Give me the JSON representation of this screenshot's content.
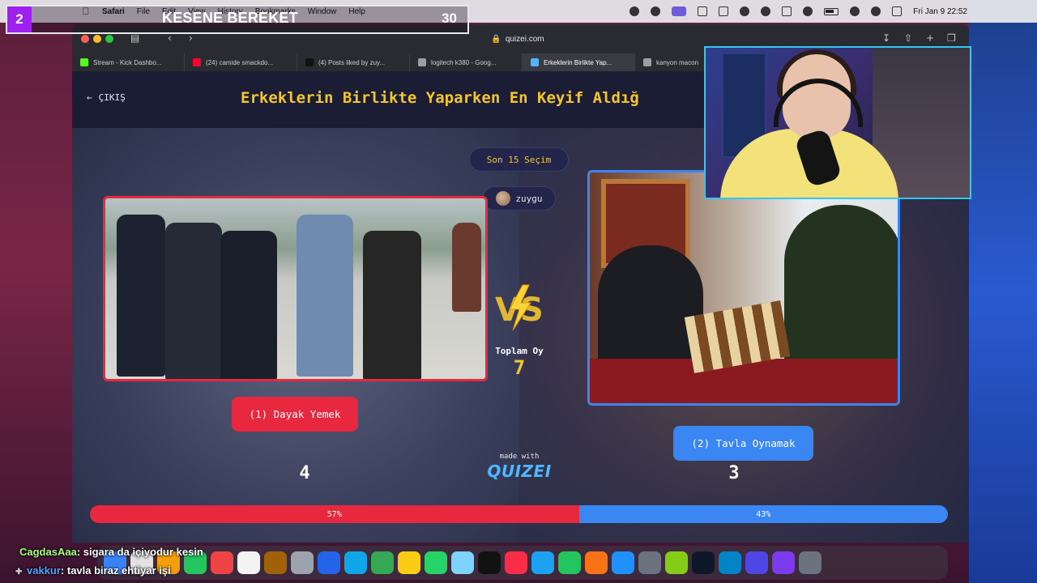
{
  "menubar": {
    "app": "Safari",
    "menus": [
      "File",
      "Edit",
      "View",
      "History",
      "Bookmarks",
      "Window",
      "Help"
    ],
    "clock": "Fri Jan 9  22:52"
  },
  "overlay": {
    "index": "2",
    "title": "KESENE BEREKET",
    "count": "30"
  },
  "browser": {
    "url": "quizei.com",
    "tabs": [
      {
        "label": "Stream - Kick Dashbo...",
        "color": "#53fc18",
        "active": false
      },
      {
        "label": "(24) camide smackdo...",
        "color": "#ff0033",
        "active": false
      },
      {
        "label": "(4) Posts liked by zuy...",
        "color": "#111111",
        "active": false
      },
      {
        "label": "logitech k380 - Goog...",
        "color": "#9aa0a6",
        "active": false
      },
      {
        "label": "Erkeklerin Birlikte Yap...",
        "color": "#4fb6ff",
        "active": true
      },
      {
        "label": "kanyon macon",
        "color": "#9aa0a6",
        "active": false
      }
    ]
  },
  "quiz": {
    "back_label": "ÇIKIŞ",
    "title": "Erkeklerin Birlikte Yaparken En Keyif Aldığ",
    "recent_label": "Son 15 Seçim",
    "username": "zuygu",
    "total_label": "Toplam Oy",
    "total_votes": "7",
    "made_with": "made with",
    "brand": "QUIZEI",
    "options": [
      {
        "label": "(1) Dayak Yemek",
        "votes": "4",
        "percent_label": "57%",
        "percent": 57,
        "color": "#e8283e"
      },
      {
        "label": "(2) Tavla Oynamak",
        "votes": "3",
        "percent_label": "43%",
        "percent": 43,
        "color": "#3a86f2"
      }
    ]
  },
  "chat": [
    {
      "user": "CagdasAaa",
      "message": ": sigara da içiyodur kesin"
    },
    {
      "user": "vakkur",
      "message": ": tavla biraz ehtiyar işi"
    }
  ],
  "colors": {
    "accent_yellow": "#f4c531",
    "option1": "#e8283e",
    "option2": "#3a86f2",
    "overlay_purple": "#a020f0"
  }
}
